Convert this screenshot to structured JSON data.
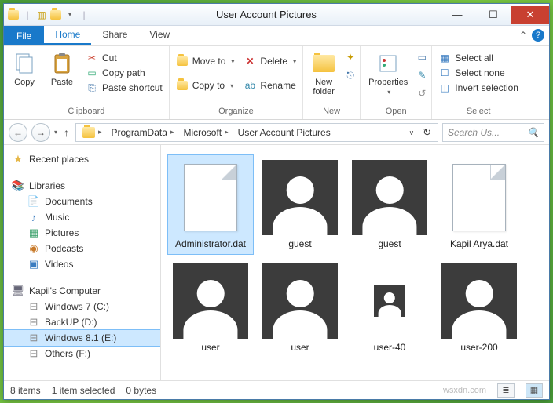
{
  "window": {
    "title": "User Account Pictures"
  },
  "menu": {
    "file": "File",
    "home": "Home",
    "share": "Share",
    "view": "View"
  },
  "ribbon": {
    "clipboard": {
      "label": "Clipboard",
      "copy": "Copy",
      "paste": "Paste",
      "cut": "Cut",
      "copy_path": "Copy path",
      "paste_shortcut": "Paste shortcut"
    },
    "organize": {
      "label": "Organize",
      "move_to": "Move to",
      "copy_to": "Copy to",
      "delete": "Delete",
      "rename": "Rename"
    },
    "new": {
      "label": "New",
      "new_folder": "New\nfolder"
    },
    "open": {
      "label": "Open",
      "properties": "Properties"
    },
    "select": {
      "label": "Select",
      "select_all": "Select all",
      "select_none": "Select none",
      "invert": "Invert selection"
    }
  },
  "breadcrumbs": [
    "ProgramData",
    "Microsoft",
    "User Account Pictures"
  ],
  "search": {
    "placeholder": "Search Us..."
  },
  "nav": {
    "recent": "Recent places",
    "libraries": {
      "label": "Libraries",
      "items": [
        "Documents",
        "Music",
        "Pictures",
        "Podcasts",
        "Videos"
      ]
    },
    "computer": {
      "label": "Kapil's Computer",
      "items": [
        "Windows 7 (C:)",
        "BackUP (D:)",
        "Windows 8.1 (E:)",
        "Others (F:)"
      ],
      "selected_index": 2
    }
  },
  "files": [
    {
      "name": "Administrator.dat",
      "type": "dat",
      "selected": true
    },
    {
      "name": "guest",
      "type": "avatar"
    },
    {
      "name": "guest",
      "type": "avatar"
    },
    {
      "name": "Kapil Arya.dat",
      "type": "dat"
    },
    {
      "name": "user",
      "type": "avatar"
    },
    {
      "name": "user",
      "type": "avatar"
    },
    {
      "name": "user-40",
      "type": "avatar-sm"
    },
    {
      "name": "user-200",
      "type": "avatar"
    }
  ],
  "status": {
    "count": "8 items",
    "selection": "1 item selected",
    "size": "0 bytes"
  },
  "watermark": "wsxdn.com"
}
